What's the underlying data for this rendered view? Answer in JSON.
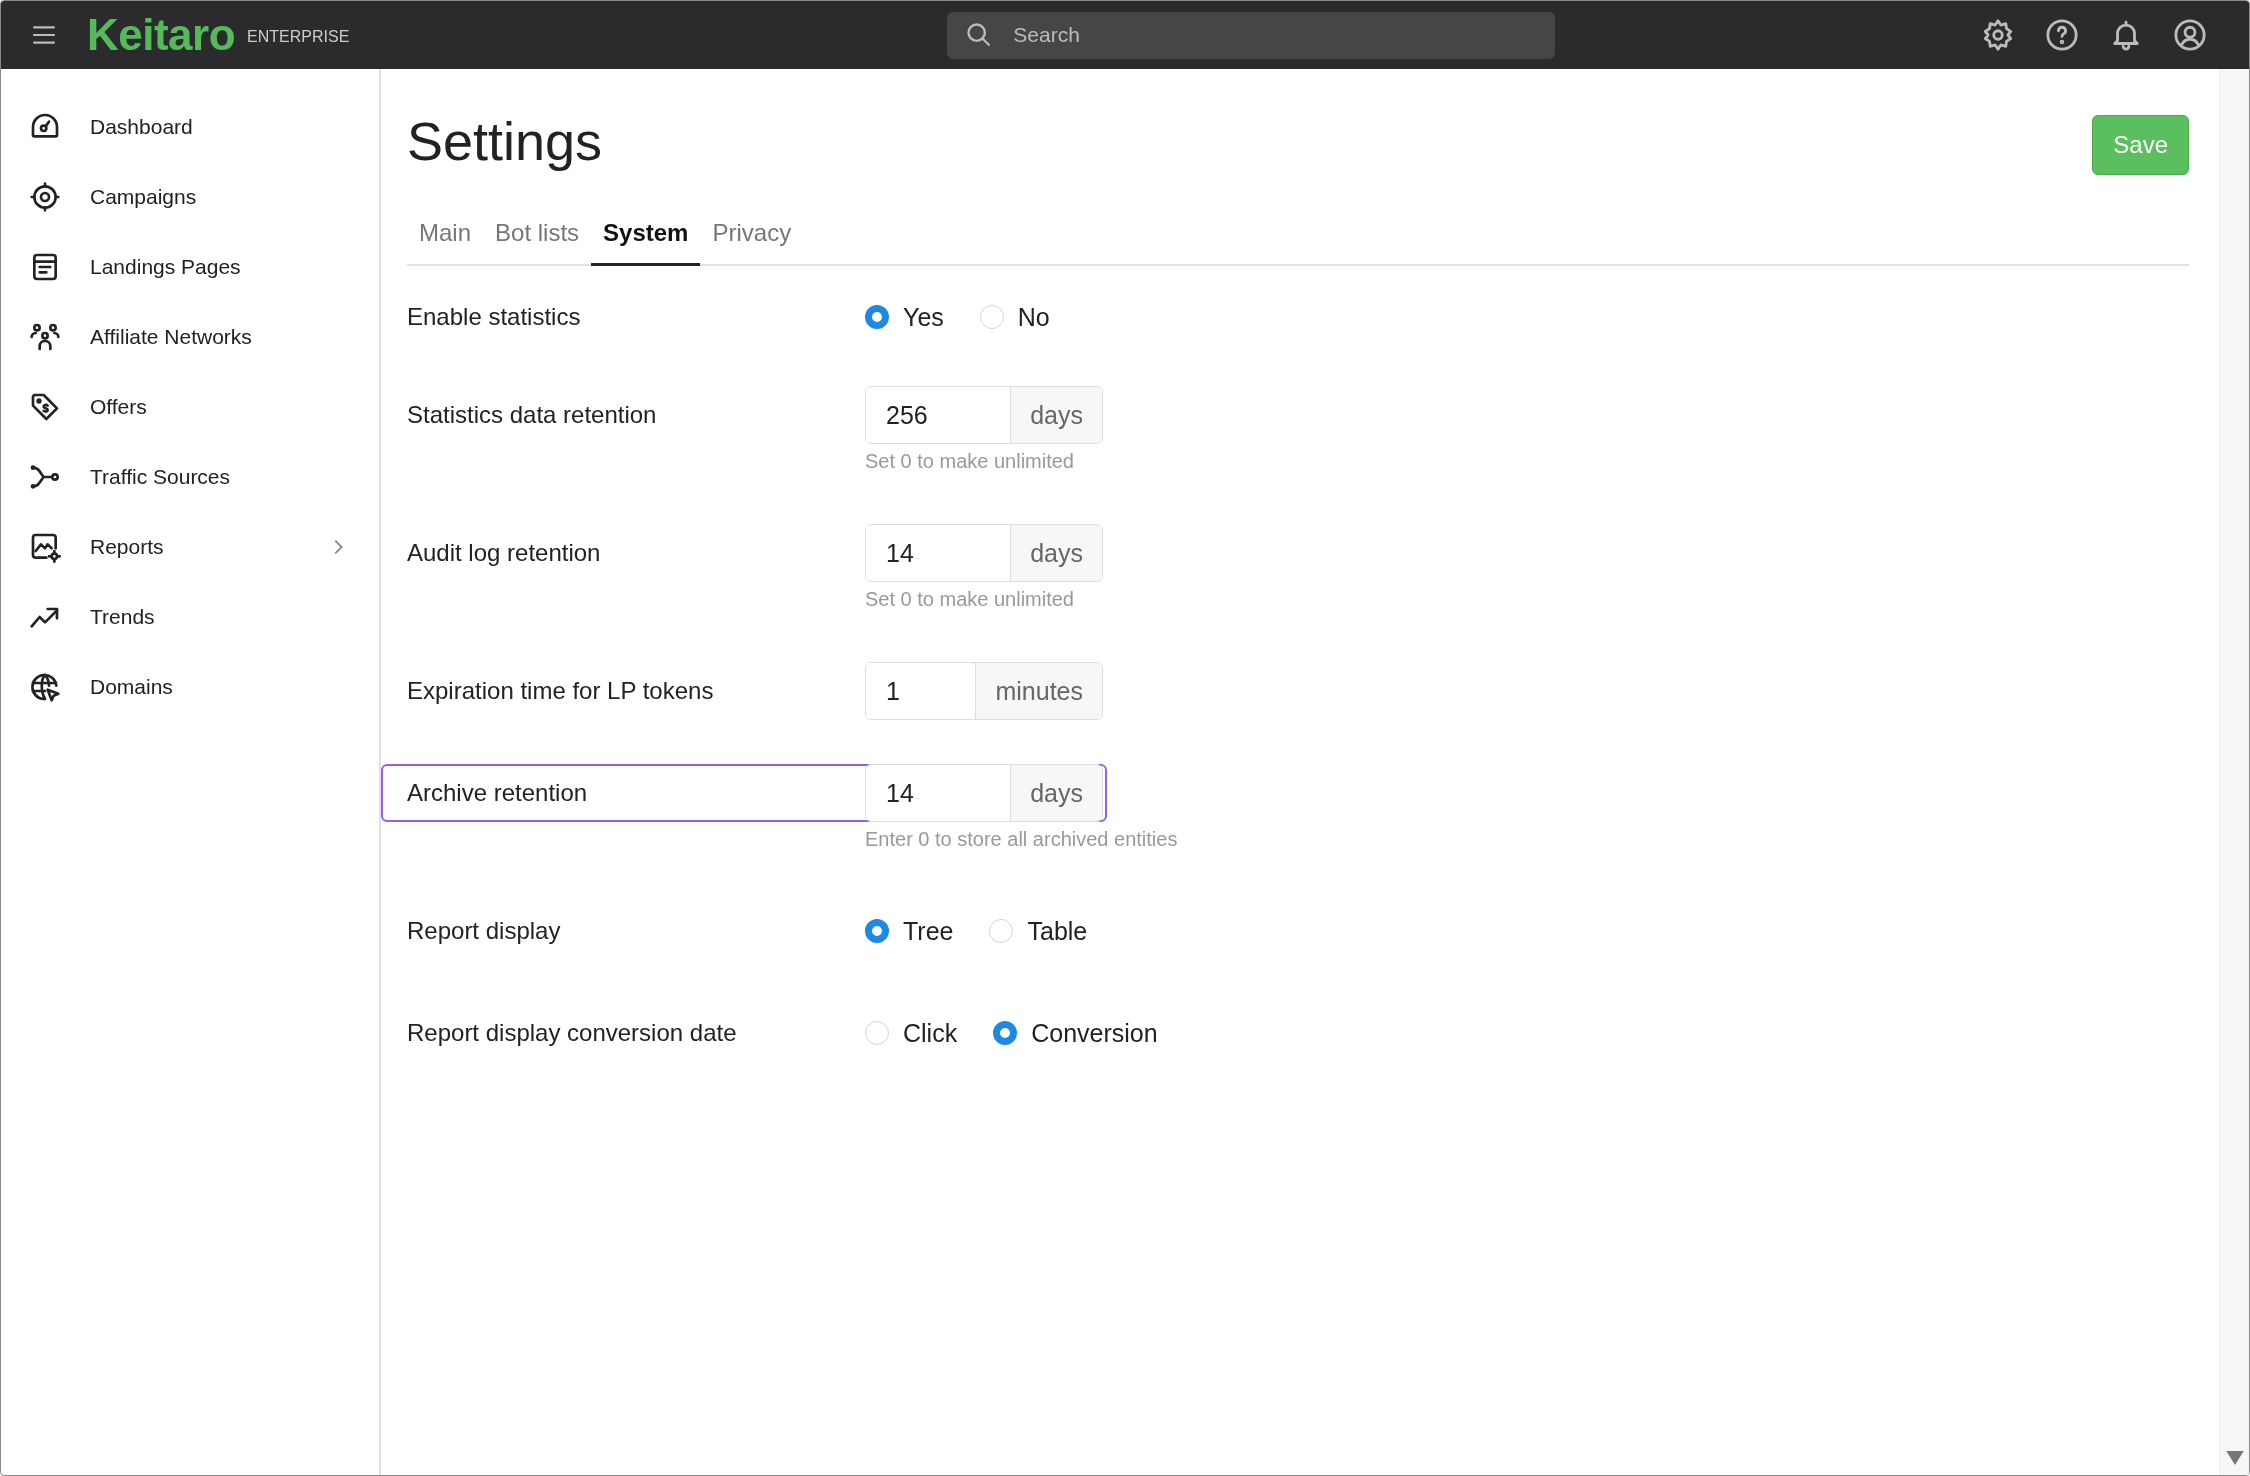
{
  "header": {
    "logo": "Keitaro",
    "edition": "ENTERPRISE",
    "search": {
      "placeholder": "Search"
    }
  },
  "sidebar": {
    "items": [
      {
        "label": "Dashboard",
        "expandable": false
      },
      {
        "label": "Campaigns",
        "expandable": false
      },
      {
        "label": "Landings Pages",
        "expandable": false
      },
      {
        "label": "Affiliate Networks",
        "expandable": false
      },
      {
        "label": "Offers",
        "expandable": false
      },
      {
        "label": "Traffic Sources",
        "expandable": false
      },
      {
        "label": "Reports",
        "expandable": true
      },
      {
        "label": "Trends",
        "expandable": false
      },
      {
        "label": "Domains",
        "expandable": false
      }
    ]
  },
  "page": {
    "title": "Settings",
    "save_button": "Save",
    "tabs": [
      {
        "label": "Main",
        "selected": false
      },
      {
        "label": "Bot lists",
        "selected": false
      },
      {
        "label": "System",
        "selected": true
      },
      {
        "label": "Privacy",
        "selected": false
      }
    ],
    "rows": [
      {
        "kind": "radio",
        "label": "Enable statistics",
        "highlighted": false,
        "options": [
          {
            "label": "Yes",
            "selected": true
          },
          {
            "label": "No",
            "selected": false
          }
        ]
      },
      {
        "kind": "input",
        "label": "Statistics data retention",
        "highlighted": false,
        "value": "256",
        "unit": "days",
        "hint": "Set 0 to make unlimited"
      },
      {
        "kind": "input",
        "label": "Audit log retention",
        "highlighted": false,
        "value": "14",
        "unit": "days",
        "hint": "Set 0 to make unlimited"
      },
      {
        "kind": "input",
        "label": "Expiration time for LP tokens",
        "highlighted": false,
        "value": "1",
        "unit": "minutes"
      },
      {
        "kind": "input",
        "label": "Archive retention",
        "highlighted": true,
        "value": "14",
        "unit": "days",
        "hint": "Enter 0 to store all archived entities"
      },
      {
        "kind": "radio",
        "label": "Report display",
        "highlighted": false,
        "options": [
          {
            "label": "Tree",
            "selected": true
          },
          {
            "label": "Table",
            "selected": false
          }
        ]
      },
      {
        "kind": "radio",
        "label": "Report display conversion date",
        "highlighted": false,
        "options": [
          {
            "label": "Click",
            "selected": false
          },
          {
            "label": "Conversion",
            "selected": true
          }
        ]
      }
    ]
  }
}
